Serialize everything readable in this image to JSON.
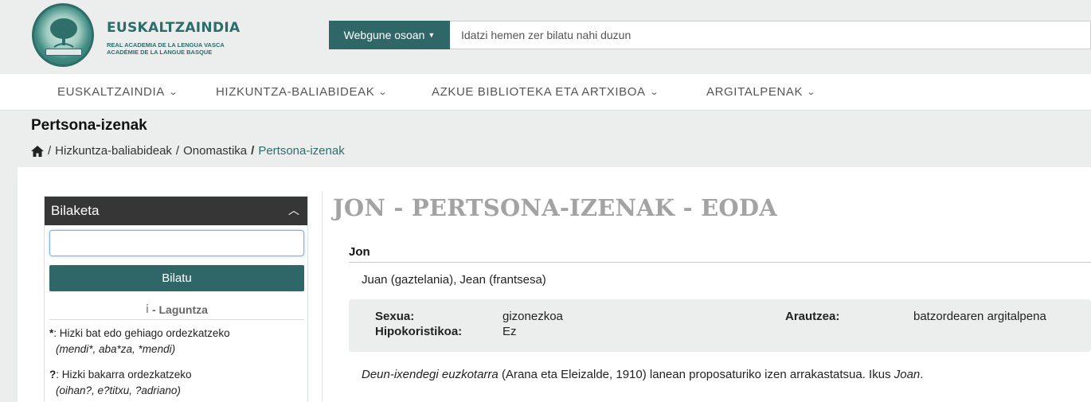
{
  "header": {
    "logo_title": "EUSKALTZAINDIA",
    "logo_sub1": "REAL ACADEMIA DE LA LENGUA VASCA",
    "logo_sub2": "ACADÉMIE DE LA LANGUE BASQUE",
    "search_scope": "Webgune osoan",
    "search_placeholder": "Idatzi hemen zer bilatu nahi duzun",
    "brand_color": "#2f6769"
  },
  "nav": {
    "items": [
      {
        "label": "EUSKALTZAINDIA"
      },
      {
        "label": "HIZKUNTZA-BALIABIDEAK"
      },
      {
        "label": "AZKUE BIBLIOTEKA ETA ARTXIBOA"
      },
      {
        "label": "ARGITALPENAK"
      }
    ]
  },
  "page": {
    "title": "Pertsona-izenak",
    "breadcrumb": [
      "/",
      "Hizkuntza-baliabideak",
      "/",
      "Onomastika",
      "/",
      "Pertsona-izenak"
    ]
  },
  "sidebar": {
    "heading": "Bilaketa",
    "search_value": "",
    "search_button": "Bilatu",
    "help_icon": "i",
    "help_label": "- Laguntza",
    "rules": [
      {
        "symbol": "*",
        "text": ": Hizki bat edo gehiago ordezkatzeko",
        "example": "(mendi*, aba*za, *mendi)"
      },
      {
        "symbol": "?",
        "text": ": Hizki bakarra ordezkatzeko",
        "example": "(oihan?, e?titxu, ?adriano)"
      }
    ]
  },
  "main": {
    "heading": "JON - PERTSONA-IZENAK - EODA",
    "entry_name": "Jon",
    "equivalents": "Juan (gaztelania), Jean (frantsesa)",
    "info": {
      "sexua_label": "Sexua:",
      "sexua_value": "gizonezkoa",
      "hipokoristikoa_label": "Hipokoristikoa:",
      "hipokoristikoa_value": "Ez",
      "arautzea_label": "Arautzea:",
      "arautzea_value": "batzordearen argitalpena"
    },
    "description": {
      "work": "Deun-ixendegi euzkotarra",
      "text": " (Arana eta Eleizalde, 1910) lanean proposaturiko izen arrakastatsua. Ikus ",
      "link": "Joan",
      "end": "."
    }
  }
}
